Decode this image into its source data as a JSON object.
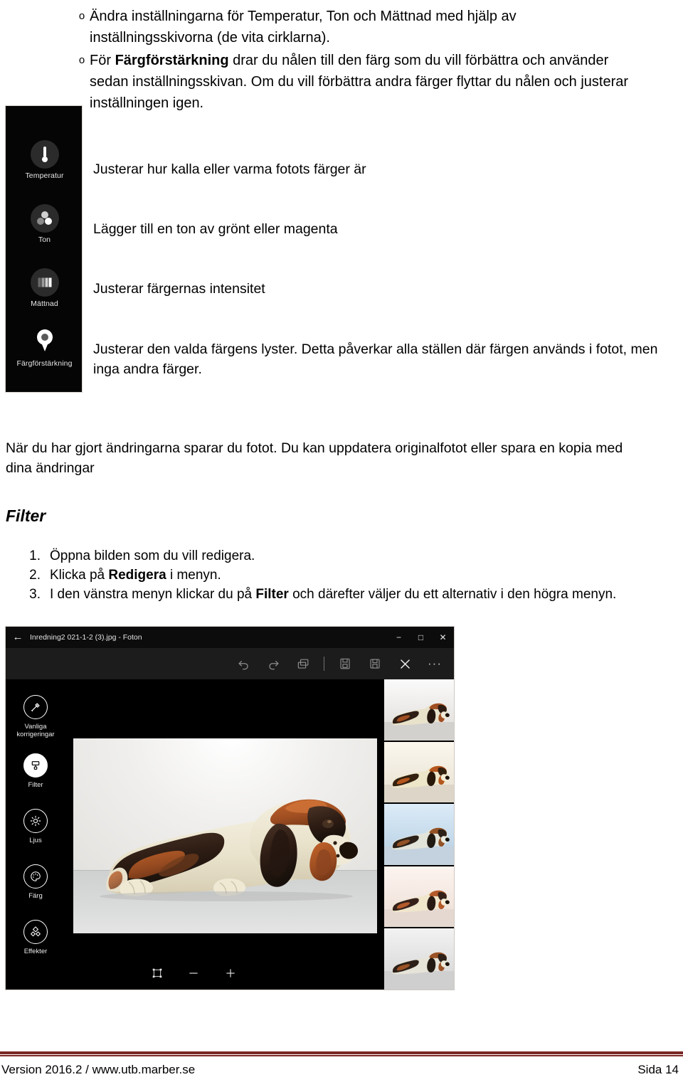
{
  "bullets": [
    {
      "marker": "o",
      "text_parts": [
        {
          "t": "Ändra inställningarna för Temperatur, Ton och Mättnad med hjälp av inställningsskivorna (de vita cirklarna).",
          "bold": false
        }
      ],
      "text": "Ändra inställningarna för Temperatur, Ton och Mättnad med hjälp av inställningsskivorna (de vita cirklarna)."
    },
    {
      "marker": "o",
      "pre": "För ",
      "bold": "Färgförstärkning",
      "post": " drar du nålen till den färg som du vill förbättra och använder sedan inställningsskivan. Om du vill förbättra andra färger flyttar du nålen och justerar inställningen igen."
    }
  ],
  "settings_panel": {
    "items": [
      {
        "label": "Temperatur",
        "icon": "thermometer-icon"
      },
      {
        "label": "Ton",
        "icon": "tone-circles-icon"
      },
      {
        "label": "Mättnad",
        "icon": "saturation-bars-icon"
      },
      {
        "label": "Färgförstärkning",
        "icon": "color-pin-icon"
      }
    ]
  },
  "descriptions": [
    "Justerar hur kalla eller varma fotots färger är",
    "Lägger till en ton av grönt eller magenta",
    "Justerar färgernas intensitet",
    "Justerar den valda färgens lyster. Detta påverkar alla ställen där färgen används i fotot, men inga andra färger."
  ],
  "save_paragraph": "När du har gjort ändringarna sparar du fotot. Du kan uppdatera originalfotot eller spara en kopia med dina ändringar",
  "filter_heading": "Filter",
  "steps": [
    {
      "num": "1.",
      "pre": "Öppna bilden som du vill redigera.",
      "bold": "",
      "post": ""
    },
    {
      "num": "2.",
      "pre": "Klicka på ",
      "bold": "Redigera",
      "post": " i menyn."
    },
    {
      "num": "3.",
      "pre": "I den vänstra menyn klickar du på ",
      "bold": "Filter",
      "post": " och därefter väljer du ett alternativ i den högra menyn."
    }
  ],
  "photos_app": {
    "titlebar": {
      "back_icon": "back-arrow-icon",
      "title": "Inredning2 021-1-2 (3).jpg - Foton",
      "minimize": "−",
      "maximize": "□",
      "close": "✕"
    },
    "toolbar": [
      {
        "name": "undo-icon",
        "glyph": "↺",
        "enabled": false
      },
      {
        "name": "redo-icon",
        "glyph": "↻",
        "enabled": false
      },
      {
        "name": "compare-icon",
        "glyph": "❐",
        "enabled": false
      },
      {
        "name": "separator",
        "glyph": "",
        "enabled": false
      },
      {
        "name": "save-copy-icon",
        "glyph": "▤",
        "enabled": false
      },
      {
        "name": "save-icon",
        "glyph": "▣",
        "enabled": false
      },
      {
        "name": "close-edit-icon",
        "glyph": "✕",
        "enabled": true
      },
      {
        "name": "more-options-icon",
        "glyph": "···",
        "enabled": true
      }
    ],
    "sidebar": [
      {
        "label_line1": "Vanliga",
        "label_line2": "korrigeringar",
        "icon": "magic-wand-icon",
        "active": false
      },
      {
        "label_line1": "Filter",
        "label_line2": "",
        "icon": "filter-brush-icon",
        "active": true
      },
      {
        "label_line1": "Ljus",
        "label_line2": "",
        "icon": "brightness-icon",
        "active": false
      },
      {
        "label_line1": "Färg",
        "label_line2": "",
        "icon": "color-palette-icon",
        "active": false
      },
      {
        "label_line1": "Effekter",
        "label_line2": "",
        "icon": "effects-icon",
        "active": false
      }
    ],
    "bottombar": [
      {
        "name": "fit-to-window-icon",
        "glyph": "⛶"
      },
      {
        "name": "zoom-out-icon",
        "glyph": "−"
      },
      {
        "name": "zoom-in-icon",
        "glyph": "+"
      }
    ],
    "thumbnails": [
      {
        "name": "filter-thumbnail-1",
        "wall": "#e9e7e4",
        "floor": "#d4d2cf"
      },
      {
        "name": "filter-thumbnail-2",
        "wall": "#ece9e2",
        "floor": "#dedbd2"
      },
      {
        "name": "filter-thumbnail-3",
        "wall": "#cfe0ef",
        "floor": "#c8d6e2"
      },
      {
        "name": "filter-thumbnail-4",
        "wall": "#f3e8e3",
        "floor": "#e3d7d1"
      },
      {
        "name": "filter-thumbnail-5",
        "wall": "#e4e4e4",
        "floor": "#d0d0d0"
      }
    ]
  },
  "footer": {
    "left": "Version 2016.2 / www.utb.marber.se",
    "right": "Sida 14",
    "rule_color": "#7a2725"
  }
}
